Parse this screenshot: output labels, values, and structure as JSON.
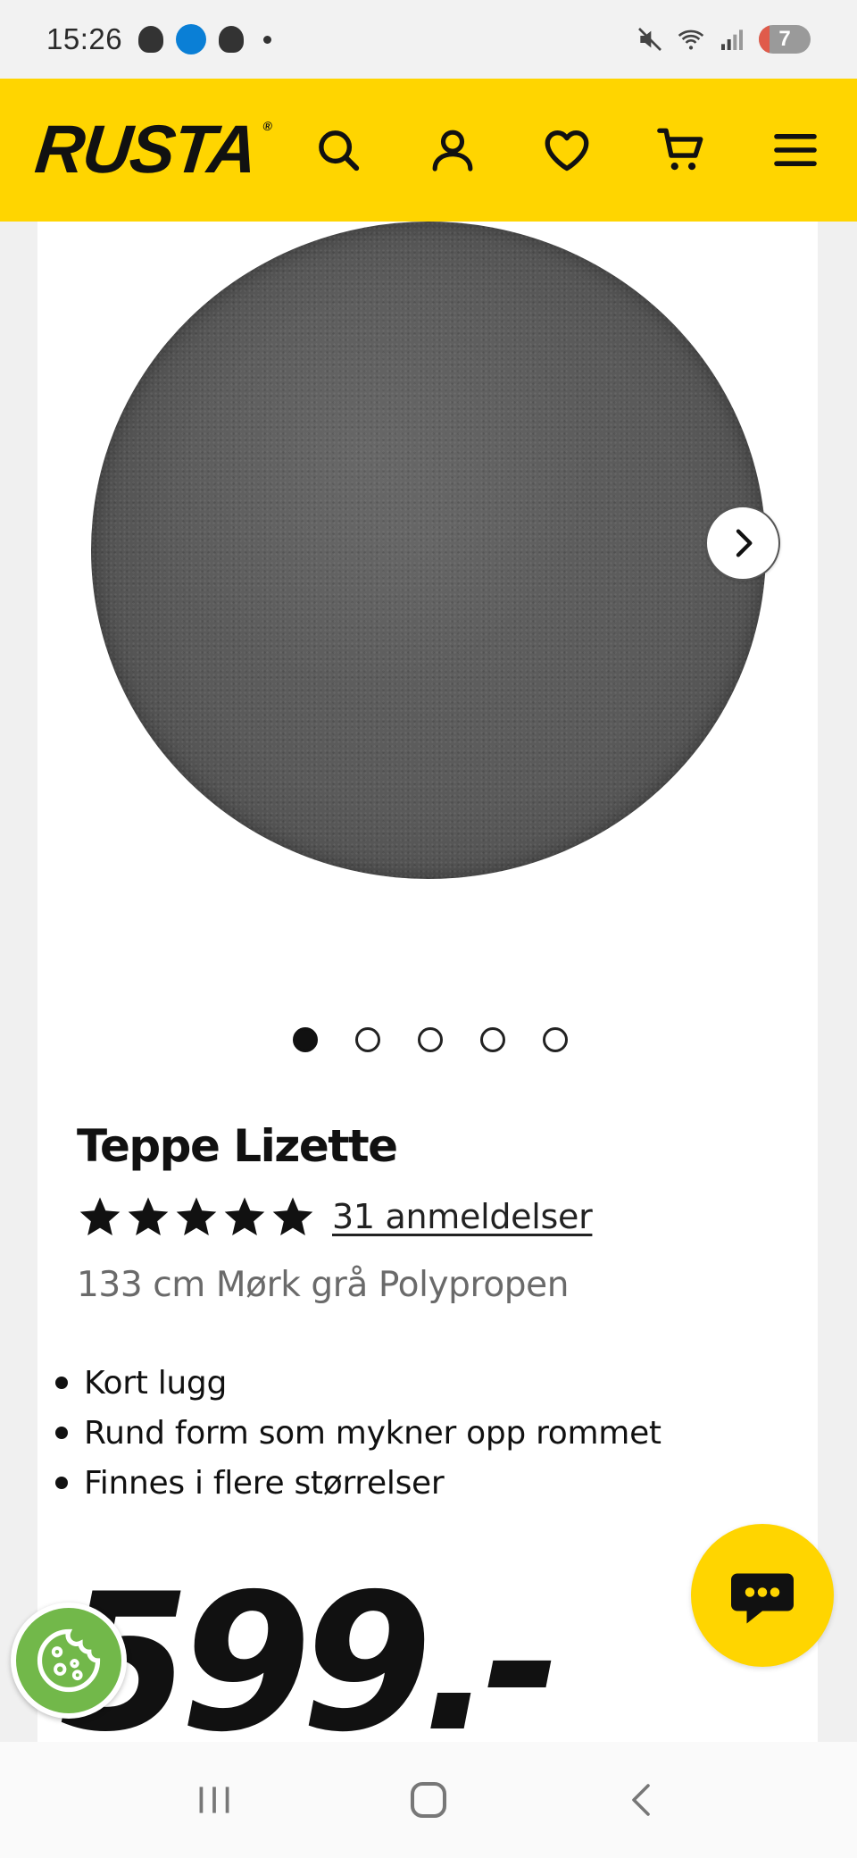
{
  "status_bar": {
    "time": "15:26",
    "battery": "7"
  },
  "header": {
    "logo": "RUSTA",
    "logo_mark": "®",
    "icons": [
      "search-icon",
      "account-icon",
      "heart-icon",
      "cart-icon",
      "menu-icon"
    ],
    "color": "#ffd500"
  },
  "gallery": {
    "total_images": 5,
    "active_index": 0
  },
  "product": {
    "title": "Teppe Lizette",
    "rating": 5,
    "reviews": "31 anmeldelser",
    "subtitle": "133 cm Mørk grå Polypropen",
    "features": [
      "Kort lugg",
      "Rund form som mykner opp rommet",
      "Finnes i flere størrelser"
    ],
    "price": "599.-"
  },
  "colors": {
    "accent": "#ffd500",
    "cookie": "#72b84a"
  }
}
